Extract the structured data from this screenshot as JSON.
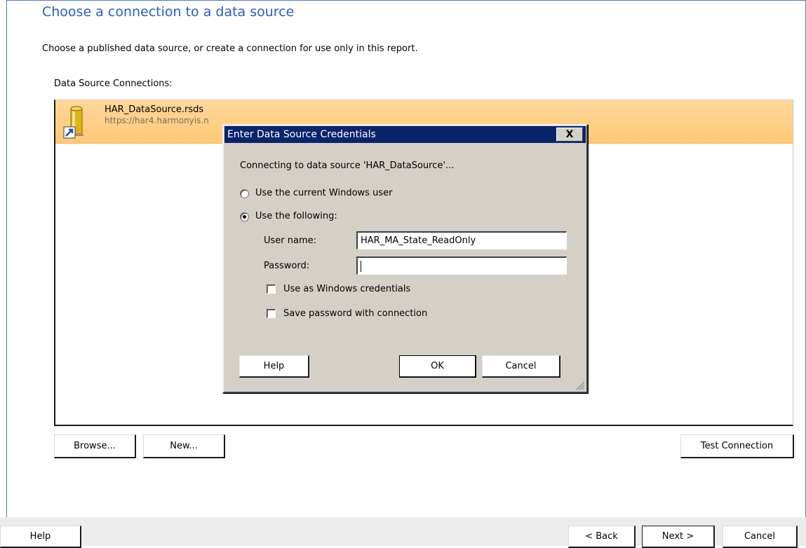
{
  "page": {
    "title": "Choose a connection to a data source",
    "description": "Choose a published data source, or create a connection for use only in this report.",
    "list_label": "Data Source Connections:"
  },
  "connections": [
    {
      "name": "HAR_DataSource.rsds",
      "url": "https://har4.harmonyis.n",
      "icon": "data-source-shortcut-icon"
    }
  ],
  "list_buttons": {
    "browse": "Browse...",
    "new": "New...",
    "test": "Test Connection"
  },
  "dialog": {
    "title": "Enter Data Source Credentials",
    "close": "X",
    "status": "Connecting to data source 'HAR_DataSource'...",
    "radio_current_user": "Use the current Windows user",
    "radio_following": "Use the following:",
    "selected_option": "Use the following:",
    "user_name_label": "User name:",
    "user_name_value": "HAR_MA_State_ReadOnly",
    "password_label": "Password:",
    "password_value": "",
    "check_windows_creds": "Use as Windows credentials",
    "check_windows_creds_checked": false,
    "check_save_password": "Save password with connection",
    "check_save_password_checked": false,
    "help": "Help",
    "ok": "OK",
    "cancel": "Cancel"
  },
  "footer": {
    "help": "Help",
    "back": "< Back",
    "next": "Next >",
    "cancel": "Cancel"
  },
  "colors": {
    "title": "#2a5dbb",
    "selected_row": "#fdc978",
    "dialog_bg": "#d4d0c8",
    "titlebar": "#0a246a"
  }
}
